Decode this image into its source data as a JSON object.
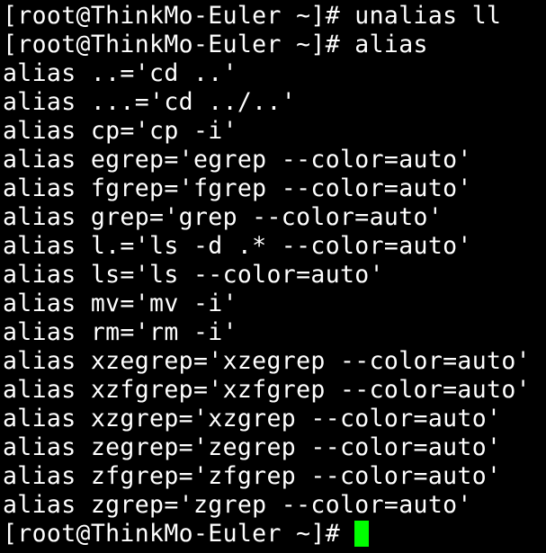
{
  "colors": {
    "background": "#000000",
    "foreground": "#ffffff",
    "cursor": "#00ff00"
  },
  "terminal": {
    "lines": [
      "[root@ThinkMo-Euler ~]# unalias ll",
      "[root@ThinkMo-Euler ~]# alias",
      "alias ..='cd ..'",
      "alias ...='cd ../..'",
      "alias cp='cp -i'",
      "alias egrep='egrep --color=auto'",
      "alias fgrep='fgrep --color=auto'",
      "alias grep='grep --color=auto'",
      "alias l.='ls -d .* --color=auto'",
      "alias ls='ls --color=auto'",
      "alias mv='mv -i'",
      "alias rm='rm -i'",
      "alias xzegrep='xzegrep --color=auto'",
      "alias xzfgrep='xzfgrep --color=auto'",
      "alias xzgrep='xzgrep --color=auto'",
      "alias zegrep='zegrep --color=auto'",
      "alias zfgrep='zfgrep --color=auto'",
      "alias zgrep='zgrep --color=auto'"
    ],
    "prompt": "[root@ThinkMo-Euler ~]# "
  }
}
